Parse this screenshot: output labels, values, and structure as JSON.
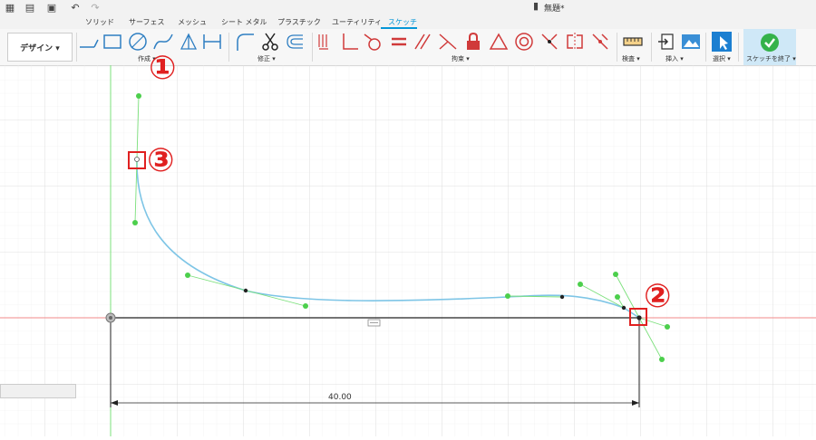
{
  "toolbar": {
    "design_label": "デザイン ▾",
    "doc_title": "無題*",
    "tabs": [
      "ソリッド",
      "サーフェス",
      "メッシュ",
      "シート メタル",
      "プラスチック",
      "ユーティリティ",
      "スケッチ"
    ],
    "groups": {
      "create": "作成 ▾",
      "modify": "修正 ▾",
      "constraints": "拘束 ▾",
      "inspect": "検査 ▾",
      "insert": "挿入 ▾",
      "select": "選択 ▾",
      "finish": "スケッチを終了 ▾"
    }
  },
  "canvas": {
    "dimension_value": "40.00"
  },
  "annotations": {
    "marker1": "①",
    "marker2": "②",
    "marker3": "③"
  },
  "colors": {
    "accent": "#0696d7",
    "curve": "#7ec5e6",
    "point": "#4ccf4c",
    "highlight": "#e02020",
    "x_axis": "#f08a8a",
    "y_axis": "#7be07b"
  }
}
